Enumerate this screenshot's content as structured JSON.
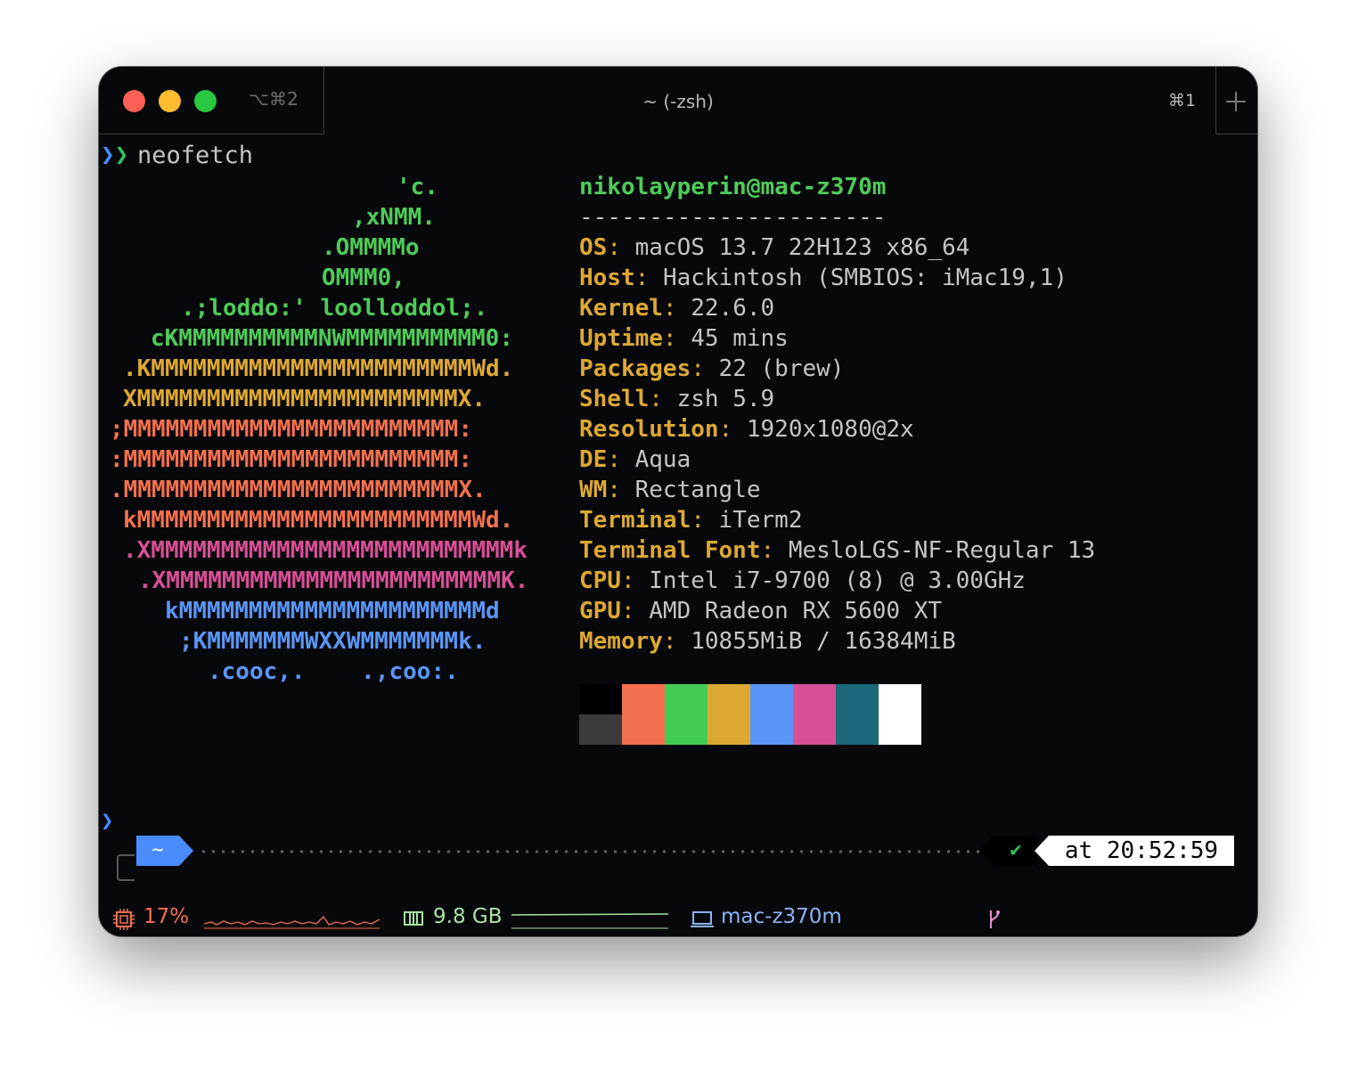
{
  "window": {
    "title": "~ (-zsh)",
    "tab_shortcut_left": "⌥⌘2",
    "tab_shortcut_right": "⌘1"
  },
  "command_line": {
    "command": "neofetch"
  },
  "neofetch": {
    "logo_lines": [
      {
        "text": "'c.",
        "color": "#4ecb58"
      },
      {
        "text": ",xNMM.",
        "color": "#4ecb58"
      },
      {
        "text": ".OMMMMo",
        "color": "#4ecb58"
      },
      {
        "text": "OMMM0,",
        "color": "#4ecb58"
      },
      {
        "text": ".;loddo:' loolloddol;.",
        "color": "#4ecb58"
      },
      {
        "text": "cKMMMMMMMMMMNWMMMMMMMMMM0:",
        "color": "#4ecb58"
      },
      {
        "text": ".KMMMMMMMMMMMMMMMMMMMMMMMWd.",
        "color": "#dda832"
      },
      {
        "text": "XMMMMMMMMMMMMMMMMMMMMMMMX.",
        "color": "#dda832"
      },
      {
        "text": ";MMMMMMMMMMMMMMMMMMMMMMMM:",
        "color": "#f3704f"
      },
      {
        "text": ":MMMMMMMMMMMMMMMMMMMMMMMM:",
        "color": "#f3704f"
      },
      {
        "text": ".MMMMMMMMMMMMMMMMMMMMMMMMX.",
        "color": "#f3704f"
      },
      {
        "text": "kMMMMMMMMMMMMMMMMMMMMMMMMWd.",
        "color": "#f3704f"
      },
      {
        "text": ".XMMMMMMMMMMMMMMMMMMMMMMMMMMk",
        "color": "#d84f96"
      },
      {
        "text": ".XMMMMMMMMMMMMMMMMMMMMMMMMK.",
        "color": "#d84f96"
      },
      {
        "text": "kMMMMMMMMMMMMMMMMMMMMMMd",
        "color": "#5b95f5"
      },
      {
        "text": ";KMMMMMMMWXXWMMMMMMMk.",
        "color": "#5b95f5"
      },
      {
        "text": ".cooc,.    .,coo:.",
        "color": "#5b95f5"
      }
    ],
    "user_host": "nikolayperin@mac-z370m",
    "separator": "----------------------",
    "info": [
      {
        "key": "OS",
        "value": "macOS 13.7 22H123 x86_64"
      },
      {
        "key": "Host",
        "value": "Hackintosh (SMBIOS: iMac19,1)"
      },
      {
        "key": "Kernel",
        "value": "22.6.0"
      },
      {
        "key": "Uptime",
        "value": "45 mins"
      },
      {
        "key": "Packages",
        "value": "22 (brew)"
      },
      {
        "key": "Shell",
        "value": "zsh 5.9"
      },
      {
        "key": "Resolution",
        "value": "1920x1080@2x"
      },
      {
        "key": "DE",
        "value": "Aqua"
      },
      {
        "key": "WM",
        "value": "Rectangle"
      },
      {
        "key": "Terminal",
        "value": "iTerm2"
      },
      {
        "key": "Terminal Font",
        "value": "MesloLGS-NF-Regular 13"
      },
      {
        "key": "CPU",
        "value": "Intel i7-9700 (8) @ 3.00GHz"
      },
      {
        "key": "GPU",
        "value": "AMD Radeon RX 5600 XT"
      },
      {
        "key": "Memory",
        "value": "10855MiB / 16384MiB"
      }
    ],
    "palette": {
      "top": [
        "#000000",
        "#f3704f",
        "#43cc55",
        "#dda832",
        "#5b95f5",
        "#d84f96",
        "#1b687a",
        "#ffffff"
      ],
      "bottom": [
        "#3b3b3b",
        "#f3704f",
        "#43cc55",
        "#dda832",
        "#5b95f5",
        "#d84f96",
        "#1b687a",
        "#ffffff"
      ]
    }
  },
  "prompt": {
    "dir": "~",
    "status_icon": "✔",
    "time_prefix": "at",
    "time": "20:52:59"
  },
  "statusbar": {
    "cpu": {
      "icon": "cpu-icon",
      "value": "17%",
      "color": "#f3704f"
    },
    "memory": {
      "icon": "memory-icon",
      "value": "9.8 GB",
      "color": "#a7e3a1"
    },
    "host": {
      "icon": "laptop-icon",
      "value": "mac-z370m",
      "color": "#8ab4f8"
    },
    "git": {
      "icon": "git-branch-icon",
      "color": "#e58fd0"
    }
  }
}
